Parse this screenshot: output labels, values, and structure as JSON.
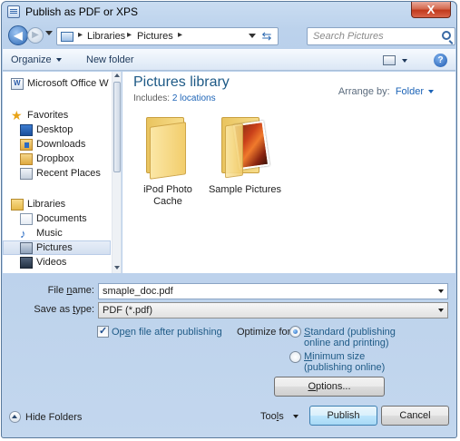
{
  "window": {
    "title": "Publish as PDF or XPS",
    "close_glyph": "X"
  },
  "address": {
    "crumbs": [
      "Libraries",
      "Pictures"
    ],
    "separator": "▸",
    "search_placeholder": "Search Pictures"
  },
  "command_bar": {
    "organize": "Organize",
    "new_folder": "New folder",
    "help_glyph": "?"
  },
  "nav": {
    "items": [
      {
        "label": "Microsoft Office W",
        "icon": "document-icon"
      },
      {
        "label": "Favorites",
        "icon": "star-icon"
      },
      {
        "label": "Desktop",
        "icon": "desktop-icon"
      },
      {
        "label": "Downloads",
        "icon": "downloads-icon"
      },
      {
        "label": "Dropbox",
        "icon": "dropbox-icon"
      },
      {
        "label": "Recent Places",
        "icon": "recent-places-icon"
      },
      {
        "label": "Libraries",
        "icon": "libraries-icon"
      },
      {
        "label": "Documents",
        "icon": "documents-icon"
      },
      {
        "label": "Music",
        "icon": "music-icon"
      },
      {
        "label": "Pictures",
        "icon": "pictures-icon",
        "selected": true
      },
      {
        "label": "Videos",
        "icon": "videos-icon"
      }
    ]
  },
  "library": {
    "title": "Pictures library",
    "includes_label": "Includes:",
    "includes_link": "2 locations",
    "arrange_label": "Arrange by:",
    "arrange_value": "Folder"
  },
  "folders": [
    {
      "name_line1": "iPod Photo",
      "name_line2": "Cache"
    },
    {
      "name_line1": "Sample Pictures",
      "name_line2": ""
    }
  ],
  "form": {
    "file_name_label_pre": "File ",
    "file_name_label_u": "n",
    "file_name_label_post": "ame:",
    "file_name_value": "smaple_doc.pdf",
    "save_type_label_pre": "Save as ",
    "save_type_label_u": "t",
    "save_type_label_post": "ype:",
    "save_type_value": "PDF (*.pdf)",
    "open_after_pre": "Op",
    "open_after_u": "e",
    "open_after_post": "n file after publishing",
    "open_after_checked": true,
    "optimize_label": "Optimize for:",
    "standard_u": "S",
    "standard_rest": "tandard (publishing",
    "standard_line2": "online and printing)",
    "standard_selected": true,
    "minimum_u": "M",
    "minimum_rest": "inimum size",
    "minimum_line2": "(publishing online)",
    "options_u": "O",
    "options_rest": "ptions..."
  },
  "footer": {
    "hide_folders": "Hide Folders",
    "tools_pre": "Too",
    "tools_u": "l",
    "tools_post": "s",
    "publish": "Publish",
    "cancel": "Cancel"
  }
}
